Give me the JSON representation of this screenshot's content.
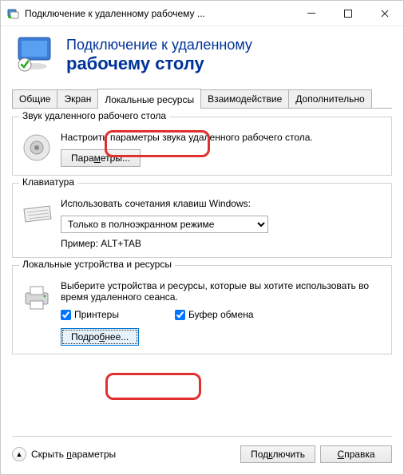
{
  "titlebar": {
    "title": "Подключение к удаленному рабочему ..."
  },
  "banner": {
    "line1": "Подключение к удаленному",
    "line2": "рабочему столу"
  },
  "tabs": {
    "t0": "Общие",
    "t1": "Экран",
    "t2": "Локальные ресурсы",
    "t3": "Взаимодействие",
    "t4": "Дополнительно"
  },
  "group_audio": {
    "title": "Звук удаленного рабочего стола",
    "desc": "Настроить параметры звука удаленного рабочего стола.",
    "button": "Параметры..."
  },
  "group_keyboard": {
    "title": "Клавиатура",
    "desc": "Использовать сочетания клавиш Windows:",
    "selected": "Только в полноэкранном режиме",
    "example": "Пример: ALT+TAB"
  },
  "group_local": {
    "title": "Локальные устройства и ресурсы",
    "desc": "Выберите устройства и ресурсы, которые вы хотите использовать во время удаленного сеанса.",
    "check_printers": "Принтеры",
    "check_clipboard": "Буфер обмена",
    "button": "Подробнее..."
  },
  "footer": {
    "collapse": "Скрыть параметры",
    "connect": "Подключить",
    "help": "Справка"
  }
}
